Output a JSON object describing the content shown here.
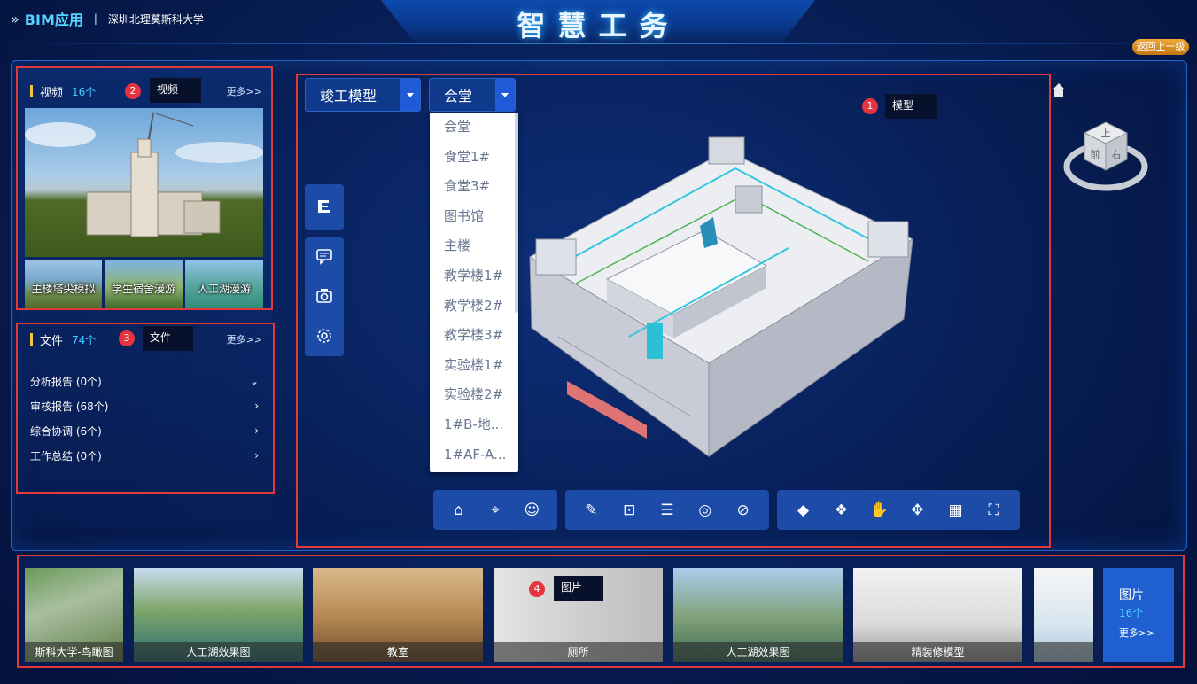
{
  "header": {
    "app_name": "BIM应用",
    "separator": "|",
    "organization": "深圳北理莫斯科大学",
    "title": "智慧工务",
    "back_label": "返回上一级"
  },
  "annotations": {
    "model": {
      "num": "1",
      "label": "模型"
    },
    "video": {
      "num": "2",
      "label": "视频"
    },
    "file": {
      "num": "3",
      "label": "文件"
    },
    "picture": {
      "num": "4",
      "label": "图片"
    }
  },
  "video_panel": {
    "title": "视频",
    "count": "16个",
    "more": "更多>>",
    "thumbs": [
      "主楼塔尖模拟",
      "学生宿舍漫游",
      "人工湖漫游"
    ]
  },
  "file_panel": {
    "title": "文件",
    "count": "74个",
    "more": "更多>>",
    "items": [
      {
        "label": "分析报告 (0个)",
        "expanded": true
      },
      {
        "label": "审核报告 (68个)",
        "expanded": false
      },
      {
        "label": "综合协调 (6个)",
        "expanded": false
      },
      {
        "label": "工作总结 (0个)",
        "expanded": false
      }
    ]
  },
  "viewer": {
    "model_select": "竣工模型",
    "building_select": "会堂",
    "building_options": [
      "会堂",
      "食堂1#",
      "食堂3#",
      "图书馆",
      "主楼",
      "教学楼1#",
      "教学楼2#",
      "教学楼3#",
      "实验楼1#",
      "实验楼2#",
      "1#B-地...",
      "1#AF-A..."
    ],
    "compass_labels": {
      "top": "上",
      "front": "前",
      "right": "右"
    }
  },
  "picture_strip": {
    "items": [
      "斯科大学-鸟瞰图",
      "人工湖效果图",
      "教室",
      "厕所",
      "人工湖效果图",
      "精装修模型",
      ""
    ],
    "more_title": "图片",
    "more_count": "16个",
    "more_label": "更多>>"
  },
  "colors": {
    "accent": "#3fd0ff",
    "annotation_red": "#e23a3a",
    "toolbar_blue": "#1c4ba8",
    "back_orange": "#e0921f"
  }
}
